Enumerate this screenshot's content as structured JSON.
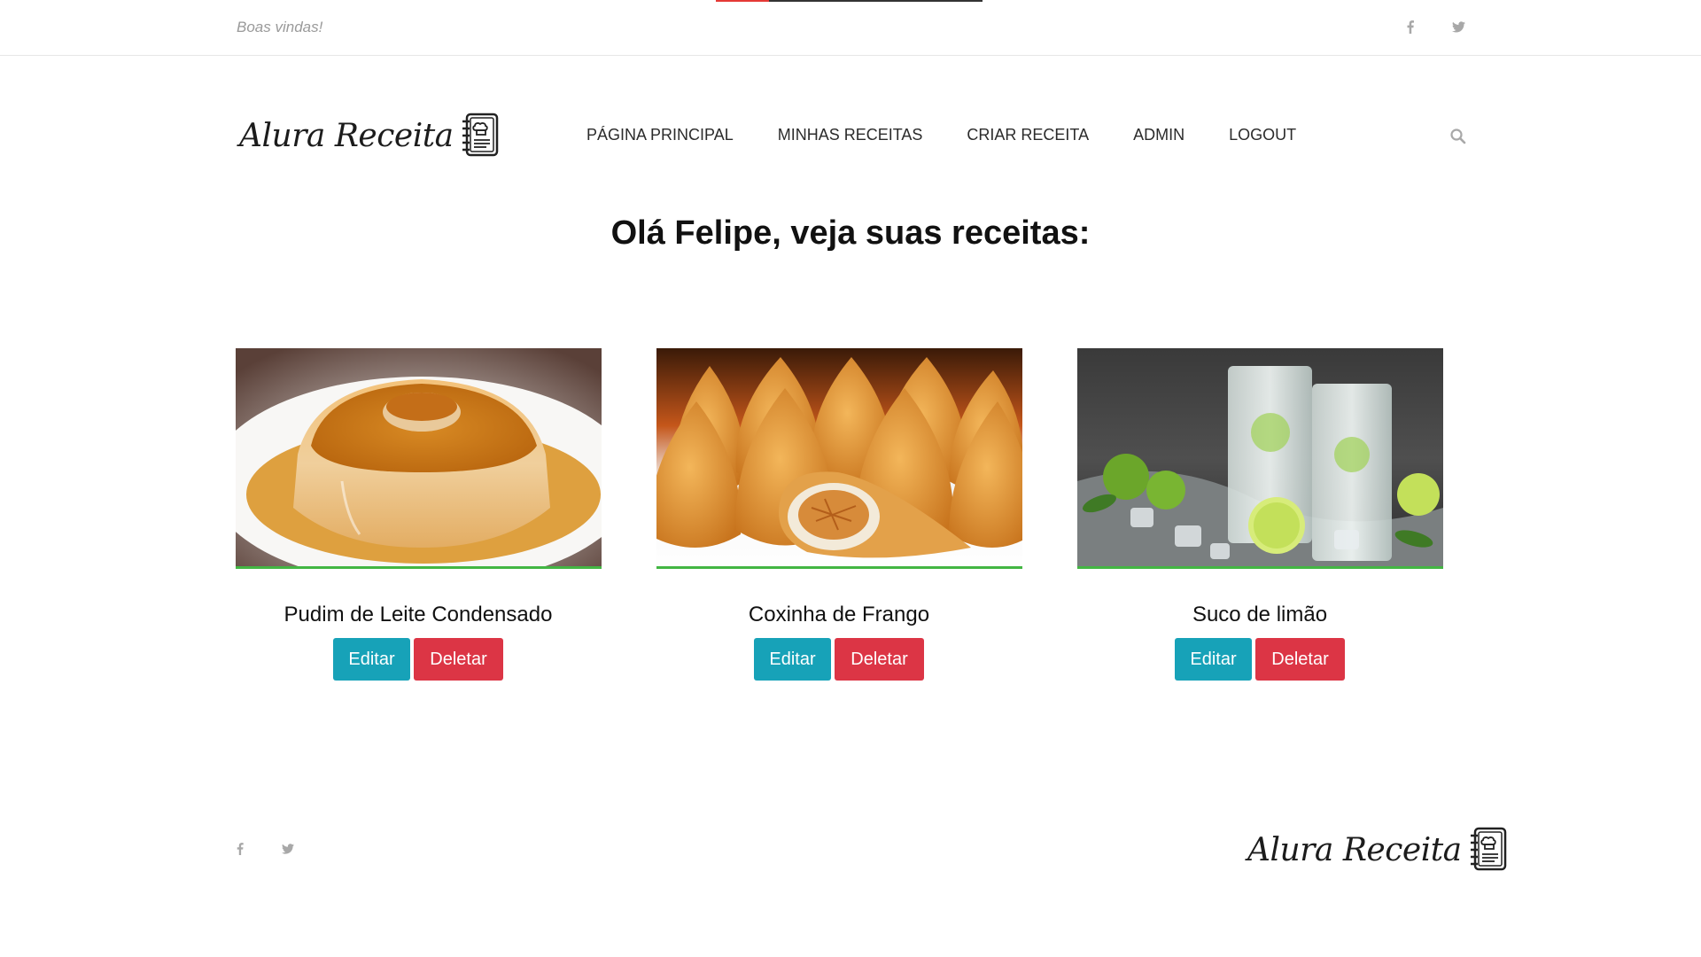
{
  "topbar": {
    "welcome": "Boas vindas!",
    "progress_fraction": 0.2,
    "icons": [
      "facebook-icon",
      "twitter-icon"
    ]
  },
  "header": {
    "logo_text": "Alura Receita",
    "nav": [
      "PÁGINA PRINCIPAL",
      "MINHAS RECEITAS",
      "CRIAR RECEITA",
      "ADMIN",
      "LOGOUT"
    ]
  },
  "main": {
    "title": "Olá Felipe, veja suas receitas:",
    "recipes": [
      {
        "name": "Pudim de Leite Condensado",
        "edit_label": "Editar",
        "delete_label": "Deletar"
      },
      {
        "name": "Coxinha de Frango",
        "edit_label": "Editar",
        "delete_label": "Deletar"
      },
      {
        "name": "Suco de limão",
        "edit_label": "Editar",
        "delete_label": "Deletar"
      }
    ]
  },
  "footer": {
    "logo_text": "Alura Receita"
  },
  "colors": {
    "edit_button": "#17a2b8",
    "delete_button": "#dc3545",
    "image_underline": "#43b643"
  }
}
